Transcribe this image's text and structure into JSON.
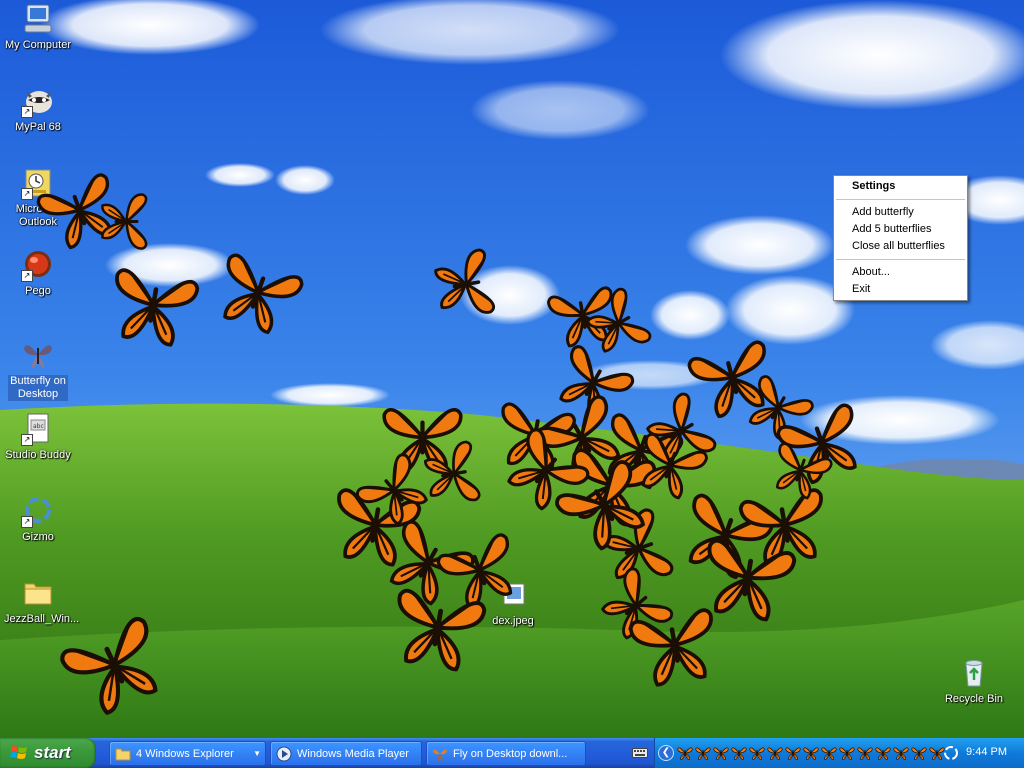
{
  "desktop": {
    "icons": [
      {
        "label": "My Computer"
      },
      {
        "label": "MyPal 68"
      },
      {
        "label": "Microsoft Outlook"
      },
      {
        "label": "Pego"
      },
      {
        "label": "Butterfly on Desktop"
      },
      {
        "label": "Studio Buddy"
      },
      {
        "label": "Gizmo"
      },
      {
        "label": "JezzBall_Win..."
      },
      {
        "label": "dex.jpeg"
      },
      {
        "label": "Recycle Bin"
      }
    ]
  },
  "context_menu": {
    "title": "Settings",
    "items": [
      "Add butterfly",
      "Add 5 butterflies",
      "Close all butterflies"
    ],
    "items2": [
      "About...",
      "Exit"
    ]
  },
  "taskbar": {
    "start_label": "start",
    "tasks": [
      {
        "label": "4 Windows Explorer"
      },
      {
        "label": "Windows Media Player"
      },
      {
        "label": "Fly on Desktop downl..."
      }
    ],
    "clock": "9:44 PM"
  },
  "colors": {
    "butterfly_orange": "#f07a10",
    "butterfly_black": "#1a0e05",
    "taskbar_blue": "#245ddb",
    "start_green": "#3c9a3c"
  }
}
